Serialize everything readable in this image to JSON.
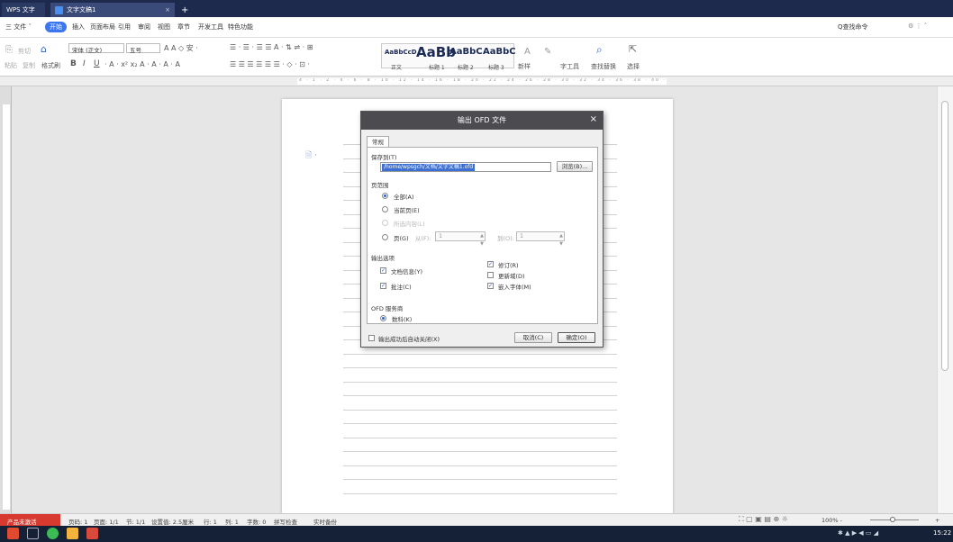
{
  "titlebar": {
    "app_tab": "WPS 文字",
    "doc_tab": "文字文稿1",
    "close": "×",
    "new_tab": "+"
  },
  "menubar": {
    "file": "三 文件 ˇ",
    "items": [
      "开始",
      "插入",
      "页面布局",
      "引用",
      "审阅",
      "视图",
      "章节",
      "开发工具",
      "特色功能"
    ],
    "search": "Q查找命令"
  },
  "toolbar": {
    "paste": "粘贴",
    "cut": "剪切",
    "copy": "复制",
    "format_painter": "格式刷",
    "font_name": "宋体 (正文)",
    "font_size": "五号",
    "bold": "B",
    "italic": "I",
    "underline": "U",
    "styles": [
      {
        "preview": "AaBbCcD",
        "label": "正文"
      },
      {
        "preview": "AaBb",
        "label": "标题 1"
      },
      {
        "preview": "AaBbC",
        "label": "标题 2"
      },
      {
        "preview": "AaBbC",
        "label": "标题 3"
      }
    ],
    "new_style": "新样",
    "text_tool": "字工具",
    "find_replace": "查找替换",
    "select": "选择"
  },
  "ruler": {
    "marks": "4 · 1 · 2 · 4 · 6 · 8 · 10 · 12 · 14 · 16 · 18 · 20 · 22 · 24 · 26 · 28 · 30 · 32 · 34 · 36 · 38 · 40 · 42 · 44 · 46"
  },
  "dialog": {
    "title": "输出 OFD 文件",
    "tab_general": "常规",
    "save_to_label": "保存到(T)",
    "save_path": "/home/wpsgch/文档/文字文稿1.ofd",
    "browse": "浏览(B)...",
    "page_range_label": "页范围",
    "range_all": "全部(A)",
    "range_current": "当前页(E)",
    "range_selection": "所选内容(L)",
    "range_pages": "页(G)",
    "from_label": "从(F):",
    "from_value": "1",
    "to_label": "到(O):",
    "to_value": "1",
    "output_options_label": "输出选项",
    "opt_doc_info": "文档信息(Y)",
    "opt_comments": "批注(C)",
    "opt_revisions": "修订(R)",
    "opt_update_fields": "更新域(D)",
    "opt_embed_fonts": "嵌入字体(M)",
    "provider_label": "OFD 服务商",
    "provider_value": "数科(K)",
    "auto_close": "输出成功后自动关闭(X)",
    "cancel": "取消(C)",
    "ok": "确定(O)",
    "close": "×"
  },
  "statusbar": {
    "activate": "产品未激活",
    "page": "页码: 1",
    "pages": "页面: 1/1",
    "section": "节: 1/1",
    "position": "设置值: 2.5厘米",
    "row": "行: 1",
    "col": "列: 1",
    "words": "字数: 0",
    "spell": "拼写检查",
    "backup": "实时备份",
    "zoom": "100% -",
    "plus": "+"
  },
  "taskbar": {
    "clock": "15:22"
  }
}
